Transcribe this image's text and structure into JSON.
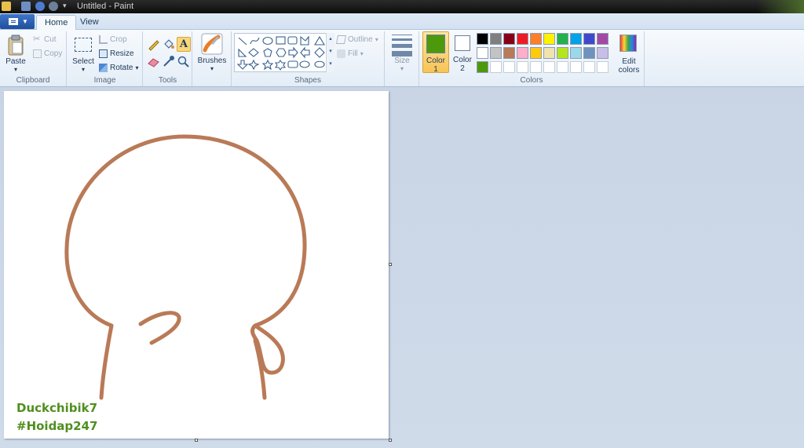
{
  "window": {
    "title": "Untitled - Paint"
  },
  "tabs": [
    {
      "label": "Home",
      "active": true
    },
    {
      "label": "View",
      "active": false
    }
  ],
  "clipboard": {
    "paste": "Paste",
    "cut": "Cut",
    "copy": "Copy",
    "group": "Clipboard"
  },
  "image": {
    "select": "Select",
    "crop": "Crop",
    "resize": "Resize",
    "rotate": "Rotate",
    "group": "Image"
  },
  "tools": {
    "group": "Tools",
    "brushes": "Brushes"
  },
  "shapes": {
    "outline": "Outline",
    "fill": "Fill",
    "group": "Shapes"
  },
  "size": {
    "label": "Size"
  },
  "colors": {
    "color1_line1": "Color",
    "color1_line2": "1",
    "color2_line1": "Color",
    "color2_line2": "2",
    "color1_value": "#4c9a0c",
    "color2_value": "#ffffff",
    "edit_line1": "Edit",
    "edit_line2": "colors",
    "group": "Colors",
    "palette_row1": [
      "#000000",
      "#7f7f7f",
      "#880015",
      "#ed1c24",
      "#ff7f27",
      "#fff200",
      "#22b14c",
      "#00a2e8",
      "#3f48cc",
      "#a349a4"
    ],
    "palette_row2": [
      "#ffffff",
      "#c3c3c3",
      "#b97a57",
      "#ffaec9",
      "#ffc90e",
      "#efe4b0",
      "#b5e61d",
      "#99d9ea",
      "#7092be",
      "#c8bfe7"
    ],
    "custom_row": [
      "#4c9a0c"
    ]
  },
  "drawing": {
    "stroke_color": "#b97a57"
  },
  "watermark": {
    "line1": "Duckchibik7",
    "line2": "#Hoidap247"
  }
}
